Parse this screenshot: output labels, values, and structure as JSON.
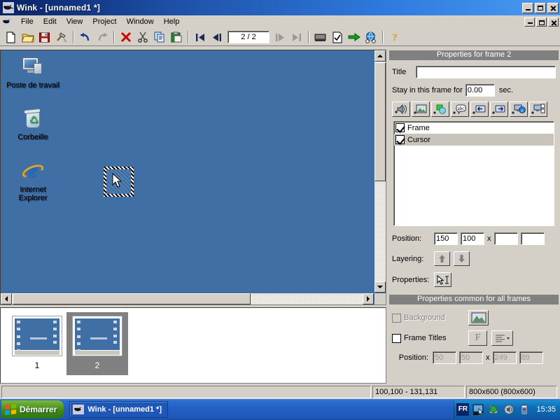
{
  "window": {
    "title": "Wink - [unnamed1 *]",
    "app_icon": "wink-fly-icon",
    "controls": {
      "minimize": "–",
      "maximize": "❐",
      "close": "✕"
    }
  },
  "menu": {
    "items": [
      {
        "label": "File"
      },
      {
        "label": "Edit"
      },
      {
        "label": "View"
      },
      {
        "label": "Project"
      },
      {
        "label": "Window"
      },
      {
        "label": "Help"
      }
    ]
  },
  "toolbar": {
    "page_indicator": "2 / 2",
    "buttons": [
      {
        "name": "new-icon",
        "title": "New"
      },
      {
        "name": "open-folder-icon",
        "title": "Open"
      },
      {
        "name": "save-disk-icon",
        "title": "Save"
      },
      {
        "name": "build-hammer-icon",
        "title": "Render"
      },
      {
        "name": "undo-arrow-icon",
        "title": "Undo"
      },
      {
        "name": "redo-arrow-icon",
        "title": "Redo"
      },
      {
        "name": "delete-x-icon",
        "title": "Delete"
      },
      {
        "name": "cut-scissors-icon",
        "title": "Cut"
      },
      {
        "name": "copy-pages-icon",
        "title": "Copy"
      },
      {
        "name": "paste-clipboard-icon",
        "title": "Paste"
      },
      {
        "name": "first-frame-icon",
        "title": "First frame"
      },
      {
        "name": "previous-frame-icon",
        "title": "Previous frame"
      },
      {
        "name": "next-frame-icon",
        "title": "Next frame"
      },
      {
        "name": "last-frame-icon",
        "title": "Last frame"
      },
      {
        "name": "capture-icon",
        "title": "Capture"
      },
      {
        "name": "render-doc-icon",
        "title": "Render project"
      },
      {
        "name": "export-arrow-icon",
        "title": "Export"
      },
      {
        "name": "browser-globe-icon",
        "title": "Preview in browser"
      },
      {
        "name": "help-question-icon",
        "title": "Help"
      }
    ]
  },
  "desktop": {
    "icons": [
      {
        "name": "my-computer",
        "label": "Poste de travail",
        "glyph": "computer-icon"
      },
      {
        "name": "recycle-bin",
        "label": "Corbeille",
        "glyph": "recycle-bin-icon"
      },
      {
        "name": "internet-explorer",
        "label": "Internet\nExplorer",
        "label_line1": "Internet",
        "label_line2": "Explorer",
        "glyph": "internet-explorer-icon"
      }
    ],
    "selected_object": "cursor-object",
    "background_color": "#3f6fa5"
  },
  "frames_strip": {
    "frames": [
      {
        "number": "1",
        "selected": false
      },
      {
        "number": "2",
        "selected": true
      }
    ]
  },
  "properties_frame": {
    "header": "Properties for frame 2",
    "title_label": "Title",
    "title_value": "",
    "stay_label": "Stay in this frame for",
    "stay_value": "0.00",
    "stay_unit": "sec.",
    "insert_buttons": [
      {
        "name": "add-sound-icon",
        "title": "Add sound"
      },
      {
        "name": "add-image-icon",
        "title": "Add image"
      },
      {
        "name": "add-shape-icon",
        "title": "Add shape"
      },
      {
        "name": "add-text-icon",
        "title": "Add text box"
      },
      {
        "name": "add-prev-button-icon",
        "title": "Add previous button"
      },
      {
        "name": "add-next-button-icon",
        "title": "Add next button"
      },
      {
        "name": "add-link-icon",
        "title": "Add browser link"
      },
      {
        "name": "add-layout-icon",
        "title": "Add frame layout"
      }
    ],
    "objects": [
      {
        "label": "Frame",
        "checked": true,
        "selected": false
      },
      {
        "label": "Cursor",
        "checked": true,
        "selected": true
      }
    ],
    "position_label": "Position:",
    "position_x": "150",
    "position_y": "100",
    "position_sep": "x",
    "position_w": "",
    "position_h": "",
    "layering_label": "Layering:",
    "layer_up": "↑",
    "layer_down": "↓",
    "properties_label": "Properties:",
    "properties_button": "cursor-properties-icon"
  },
  "properties_common": {
    "header": "Properties common for all frames",
    "background_label": "Background",
    "background_checked": false,
    "background_enabled": false,
    "background_button": "picture-icon",
    "frame_titles_label": "Frame Titles",
    "frame_titles_checked": false,
    "font_button": "F",
    "align_button": "align-left-icon",
    "position_label": "Position:",
    "position_x": "50",
    "position_y": "50",
    "position_sep": "x",
    "position_w": "249",
    "position_h": "89"
  },
  "statusbar": {
    "message": "",
    "coords": "100,100 - 131,131",
    "size": "800x600 (800x600)"
  },
  "taskbar": {
    "start_label": "Démarrer",
    "task_label": "Wink - [unnamed1 *]",
    "language": "FR",
    "tray_icons": [
      {
        "name": "screen-capture-tray-icon"
      },
      {
        "name": "shield-green-tray-icon"
      },
      {
        "name": "volume-tray-icon"
      },
      {
        "name": "battery-tray-icon"
      }
    ],
    "clock": "15:35"
  }
}
